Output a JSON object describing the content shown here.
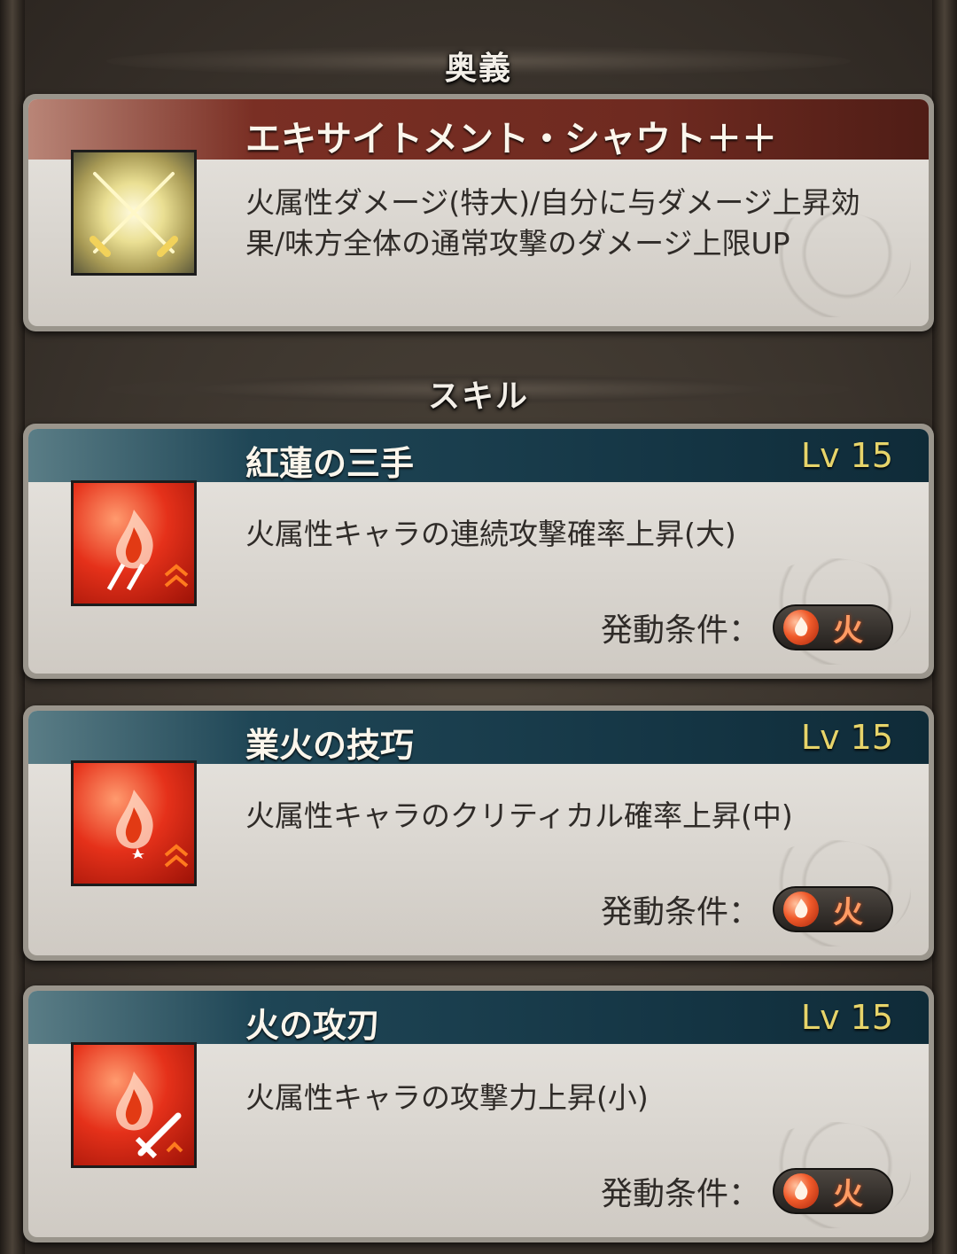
{
  "ougi_header": "奥義",
  "skill_header": "スキル",
  "ougi": {
    "name": "エキサイトメント・シャウト＋＋",
    "desc": "火属性ダメージ(特大)/自分に与ダメージ上昇効果/味方全体の通常攻撃のダメージ上限UP",
    "icon": "crossed-swords-icon"
  },
  "skills": [
    {
      "name": "紅蓮の三手",
      "level": "Lv 15",
      "desc": "火属性キャラの連続攻撃確率上昇(大)",
      "condition_label": "発動条件：",
      "condition_value": "火",
      "icon": "fire-multiattack-icon"
    },
    {
      "name": "業火の技巧",
      "level": "Lv 15",
      "desc": "火属性キャラのクリティカル確率上昇(中)",
      "condition_label": "発動条件：",
      "condition_value": "火",
      "icon": "fire-critical-icon"
    },
    {
      "name": "火の攻刃",
      "level": "Lv 15",
      "desc": "火属性キャラの攻撃力上昇(小)",
      "condition_label": "発動条件：",
      "condition_value": "火",
      "icon": "fire-attack-icon"
    }
  ],
  "colors": {
    "ougi_band": "#6e2a20",
    "skill_band": "#153645",
    "level_text": "#e7d46a",
    "fire_element": "#f05a2a"
  }
}
